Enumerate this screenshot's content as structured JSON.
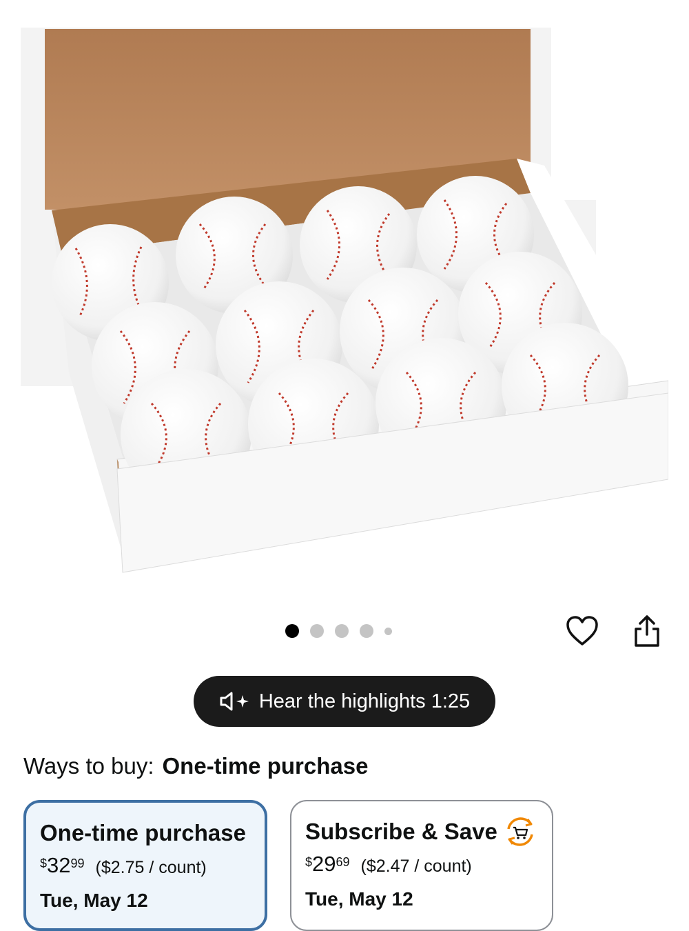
{
  "gallery": {
    "image_alt": "Box of 12 white baseballs with red stitching",
    "dot_count": 5,
    "active_index": 0
  },
  "actions": {
    "wishlist_icon": "heart-icon",
    "share_icon": "share-icon"
  },
  "audio": {
    "label": "Hear the highlights 1:25",
    "icon": "speaker-sparkle-icon"
  },
  "ways_to_buy": {
    "prefix": "Ways to buy:",
    "selected": "One-time purchase"
  },
  "options": [
    {
      "title": "One-time purchase",
      "currency": "$",
      "price_whole": "32",
      "price_fraction": "99",
      "unit_price": "($2.75 / count)",
      "delivery": "Tue, May 12",
      "selected": true
    },
    {
      "title": "Subscribe & Save",
      "currency": "$",
      "price_whole": "29",
      "price_fraction": "69",
      "unit_price": "($2.47 / count)",
      "delivery": "Tue, May 12",
      "selected": false,
      "icon": "subscribe-cart-icon"
    }
  ],
  "colors": {
    "selected_border": "#3d6fa3",
    "selected_bg": "#eef5fb",
    "pill_bg": "#1b1b1b",
    "subscribe_accent": "#f08804"
  }
}
